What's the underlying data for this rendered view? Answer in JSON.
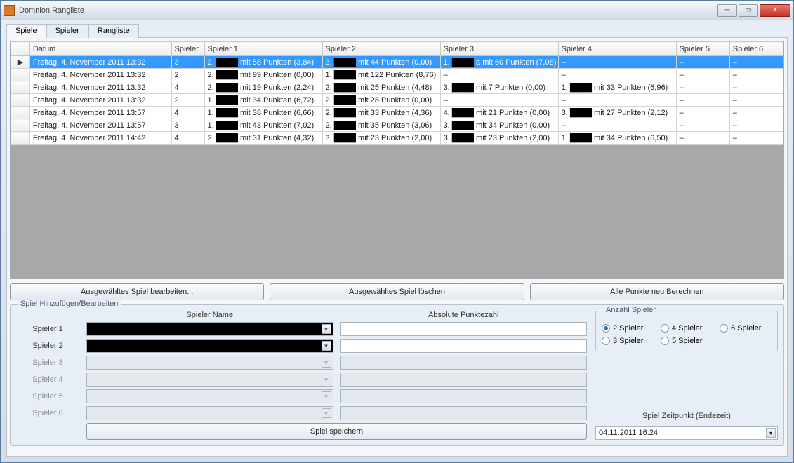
{
  "window": {
    "title": "Domnion Rangliste"
  },
  "tabs": {
    "t0": "Spiele",
    "t1": "Spieler",
    "t2": "Rangliste"
  },
  "grid": {
    "headers": {
      "datum": "Datum",
      "spieler": "Spieler",
      "s1": "Spieler 1",
      "s2": "Spieler 2",
      "s3": "Spieler 3",
      "s4": "Spieler 4",
      "s5": "Spieler 5",
      "s6": "Spieler 6"
    },
    "rows": [
      {
        "datum": "Freitag, 4. November 2011 13:32",
        "n": "3",
        "p1a": "2.",
        "p1b": "mit 58 Punkten (3,84)",
        "p2a": "3.",
        "p2b": "mit 44 Punkten (0,00)",
        "p3a": "1.",
        "p3b": "a mit 60 Punkten (7,08)",
        "p4a": "–",
        "p4b": "",
        "p5": "–",
        "p6": "–"
      },
      {
        "datum": "Freitag, 4. November 2011 13:32",
        "n": "2",
        "p1a": "2.",
        "p1b": "mit 99 Punkten (0,00)",
        "p2a": "1.",
        "p2b": "mit 122 Punkten (8,76)",
        "p3a": "–",
        "p3b": "",
        "p4a": "–",
        "p4b": "",
        "p5": "–",
        "p6": "–"
      },
      {
        "datum": "Freitag, 4. November 2011 13:32",
        "n": "4",
        "p1a": "2.",
        "p1b": "mit 19 Punkten (2,24)",
        "p2a": "2.",
        "p2b": "mit 25 Punkten (4,48)",
        "p3a": "3.",
        "p3b": "mit 7 Punkten (0,00)",
        "p4a": "1.",
        "p4b": "mit 33 Punkten (6,96)",
        "p5": "–",
        "p6": "–"
      },
      {
        "datum": "Freitag, 4. November 2011 13:32",
        "n": "2",
        "p1a": "1.",
        "p1b": "mit 34 Punkten (6,72)",
        "p2a": "2.",
        "p2b": "mit 28 Punkten (0,00)",
        "p3a": "–",
        "p3b": "",
        "p4a": "–",
        "p4b": "",
        "p5": "–",
        "p6": "–"
      },
      {
        "datum": "Freitag, 4. November 2011 13:57",
        "n": "4",
        "p1a": "1.",
        "p1b": "mit 38 Punkten (6,66)",
        "p2a": "2.",
        "p2b": "mit 33 Punkten (4,36)",
        "p3a": "4.",
        "p3b": "mit 21 Punkten (0,00)",
        "p4a": "3.",
        "p4b": "mit 27 Punkten (2,12)",
        "p5": "–",
        "p6": "–"
      },
      {
        "datum": "Freitag, 4. November 2011 13:57",
        "n": "3",
        "p1a": "1.",
        "p1b": "mit 43 Punkten (7,02)",
        "p2a": "2.",
        "p2b": "mit 35 Punkten (3,06)",
        "p3a": "3.",
        "p3b": "mit 34 Punkten (0,00)",
        "p4a": "–",
        "p4b": "",
        "p5": "–",
        "p6": "–"
      },
      {
        "datum": "Freitag, 4. November 2011 14:42",
        "n": "4",
        "p1a": "2.",
        "p1b": "mit 31 Punkten (4,32)",
        "p2a": "3.",
        "p2b": "mit 23 Punkten (2,00)",
        "p3a": "3.",
        "p3b": "mit 23 Punkten (2,00)",
        "p4a": "1.",
        "p4b": "mit 34 Punkten (6,50)",
        "p5": "–",
        "p6": "–"
      }
    ]
  },
  "buttons": {
    "edit": "Ausgewähltes Spiel bearbeiten...",
    "delete": "Ausgewähltes Spiel löschen",
    "recalc": "Alle Punkte neu Berechnen",
    "save": "Spiel speichern"
  },
  "editor": {
    "group": "Spiel Hinzufügen/Bearbeiten",
    "col_name": "Spieler Name",
    "col_points": "Absolute Punktezahl",
    "labels": {
      "s1": "Spieler 1",
      "s2": "Spieler 2",
      "s3": "Spieler 3",
      "s4": "Spieler 4",
      "s5": "Spieler 5",
      "s6": "Spieler 6"
    },
    "anzahl": {
      "legend": "Anzahl Spieler",
      "r2": "2 Spieler",
      "r3": "3 Spieler",
      "r4": "4 Spieler",
      "r5": "5 Spieler",
      "r6": "6 Spieler"
    },
    "time_label": "Spiel Zeitpunkt (Endezeit)",
    "time_value": "04.11.2011 16:24"
  }
}
